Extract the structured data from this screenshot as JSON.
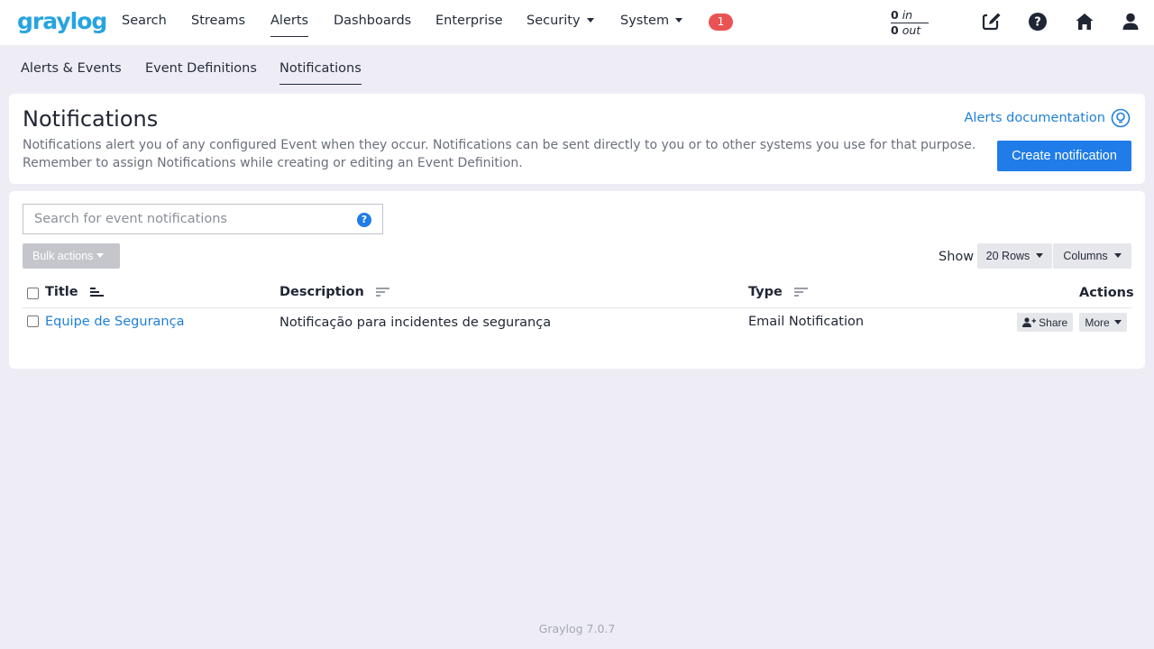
{
  "app": {
    "logo_text": "graylog",
    "version_footer": "Graylog 7.0.7"
  },
  "topnav": {
    "items": [
      {
        "label": "Search"
      },
      {
        "label": "Streams"
      },
      {
        "label": "Alerts",
        "active": true
      },
      {
        "label": "Dashboards"
      },
      {
        "label": "Enterprise"
      },
      {
        "label": "Security",
        "dropdown": true
      },
      {
        "label": "System",
        "dropdown": true
      }
    ],
    "notification_count": "1",
    "throughput": {
      "in_value": "0",
      "in_label": "in",
      "out_value": "0",
      "out_label": "out"
    },
    "icons": [
      "edit-icon",
      "help-icon",
      "home-icon",
      "user-icon"
    ]
  },
  "subnav": {
    "items": [
      {
        "label": "Alerts & Events"
      },
      {
        "label": "Event Definitions"
      },
      {
        "label": "Notifications",
        "active": true
      }
    ]
  },
  "header": {
    "title": "Notifications",
    "description": "Notifications alert you of any configured Event when they occur. Notifications can be sent directly to you or to other systems you use for that purpose. Remember to assign Notifications while creating or editing an Event Definition.",
    "doc_link": "Alerts documentation",
    "create_button": "Create notification"
  },
  "search": {
    "placeholder": "Search for event notifications",
    "value": "",
    "help": "?"
  },
  "toolbar": {
    "bulk_actions": "Bulk actions",
    "show_label": "Show",
    "rows_button": "20 Rows",
    "columns_button": "Columns"
  },
  "table": {
    "columns": [
      "Title",
      "Description",
      "Type",
      "Actions"
    ],
    "rows": [
      {
        "title": "Equipe de Segurança",
        "description": "Notificação para incidentes de segurança",
        "type": "Email Notification",
        "share_label": "Share",
        "more_label": "More"
      }
    ]
  },
  "colors": {
    "accent": "#1f7ce8",
    "link": "#1e7fd9",
    "logo": "#27a4e0",
    "badge": "#ea5353",
    "background": "#eeedf6"
  }
}
